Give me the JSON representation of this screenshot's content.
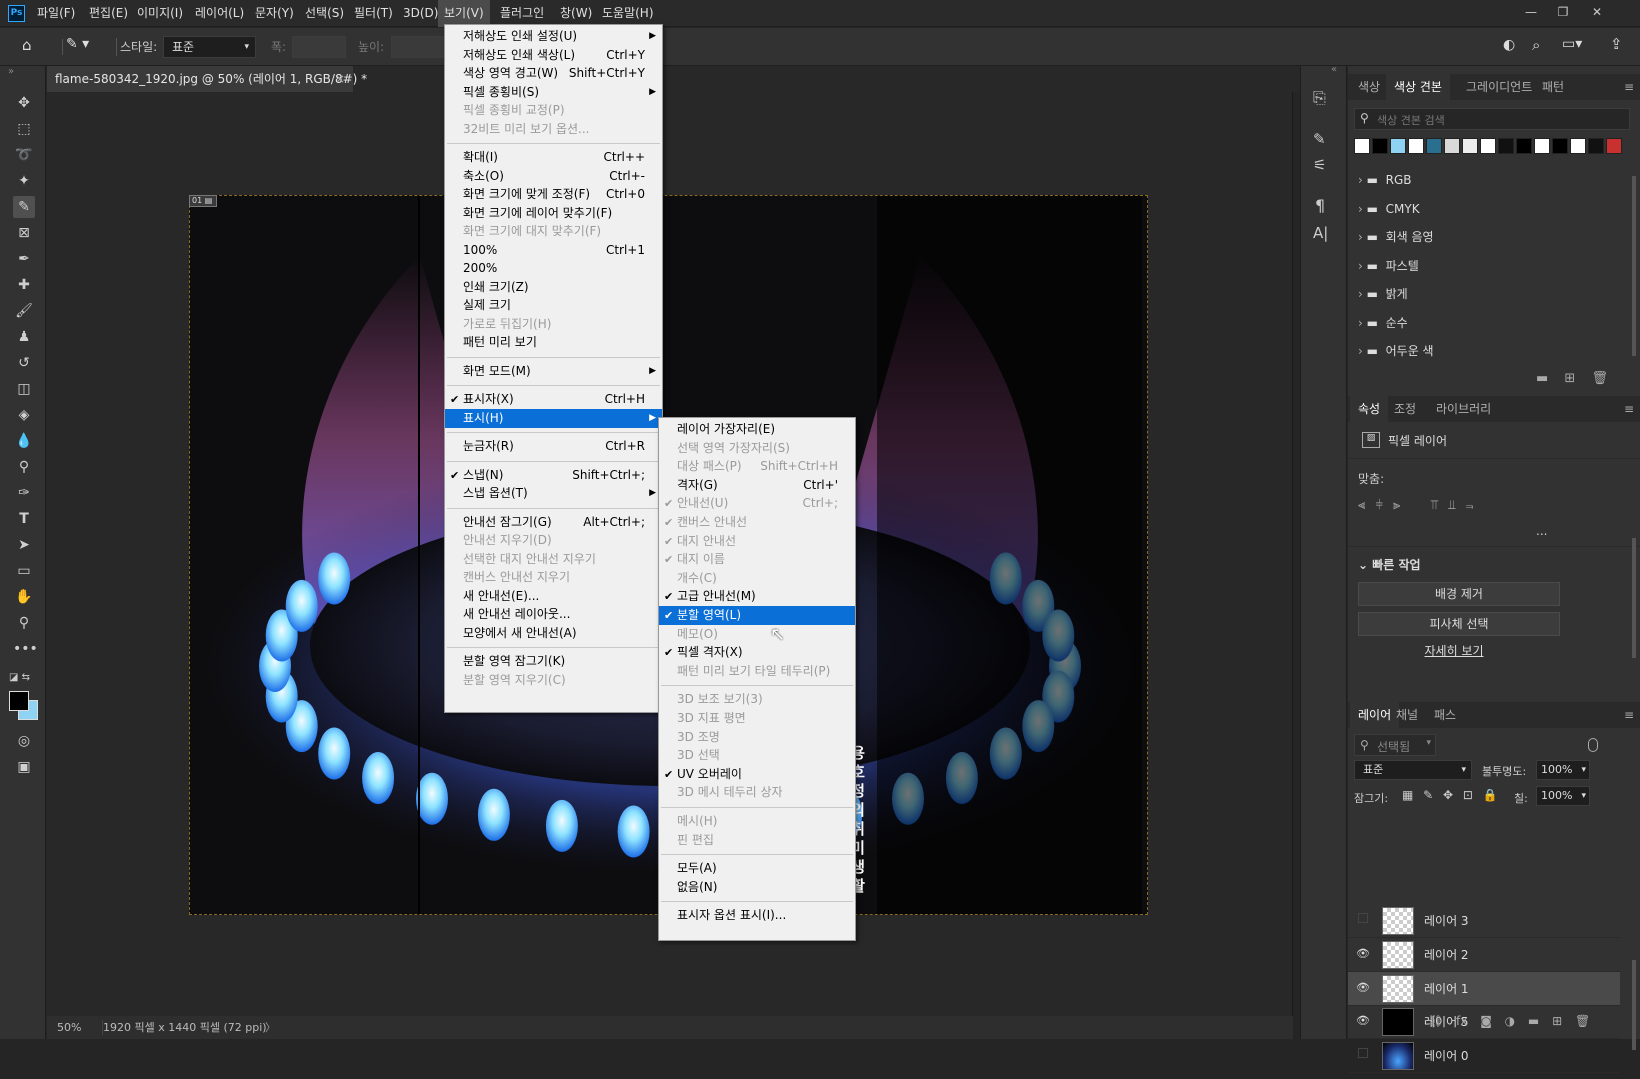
{
  "app": {
    "logo": "Ps"
  },
  "menubar": {
    "items": [
      "파일(F)",
      "편집(E)",
      "이미지(I)",
      "레이어(L)",
      "문자(Y)",
      "선택(S)",
      "필터(T)",
      "3D(D)",
      "보기(V)",
      "플러그인",
      "창(W)",
      "도움말(H)"
    ],
    "active_index": 8
  },
  "window_controls": [
    "minimize-icon",
    "restore-icon",
    "close-icon"
  ],
  "options_bar": {
    "style_label": "스타일:",
    "style_value": "표준",
    "width_label": "폭:",
    "height_label": "높이:"
  },
  "document": {
    "tab_title": "flame-580342_1920.jpg @ 50% (레이어 1, RGB/8#) *",
    "zoom": "50%",
    "info": "1920 픽셀 x 1440 픽셀 (72 ppi)",
    "watermark": "용호정의 취미생활"
  },
  "view_menu": [
    {
      "label": "저해상도 인쇄 설정(U)",
      "shortcut": "",
      "arrow": true,
      "disabled": false
    },
    {
      "label": "저해상도 인쇄 색상(L)",
      "shortcut": "Ctrl+Y",
      "disabled": false
    },
    {
      "label": "색상 영역 경고(W)",
      "shortcut": "Shift+Ctrl+Y",
      "disabled": false
    },
    {
      "label": "픽셀 종횡비(S)",
      "shortcut": "",
      "arrow": true,
      "disabled": false
    },
    {
      "label": "픽셀 종횡비 교정(P)",
      "shortcut": "",
      "disabled": true
    },
    {
      "label": "32비트 미리 보기 옵션...",
      "shortcut": "",
      "disabled": true
    },
    {
      "sep": true
    },
    {
      "label": "확대(I)",
      "shortcut": "Ctrl++",
      "disabled": false
    },
    {
      "label": "축소(O)",
      "shortcut": "Ctrl+-",
      "disabled": false
    },
    {
      "label": "화면 크기에 맞게 조정(F)",
      "shortcut": "Ctrl+0",
      "disabled": false
    },
    {
      "label": "화면 크기에 레이어 맞추기(F)",
      "shortcut": "",
      "disabled": false
    },
    {
      "label": "화면 크기에 대지 맞추기(F)",
      "shortcut": "",
      "disabled": true
    },
    {
      "label": "100%",
      "shortcut": "Ctrl+1",
      "disabled": false
    },
    {
      "label": "200%",
      "shortcut": "",
      "disabled": false
    },
    {
      "label": "인쇄 크기(Z)",
      "shortcut": "",
      "disabled": false
    },
    {
      "label": "실제 크기",
      "shortcut": "",
      "disabled": false
    },
    {
      "label": "가로로 뒤집기(H)",
      "shortcut": "",
      "disabled": true
    },
    {
      "label": "패턴 미리 보기",
      "shortcut": "",
      "disabled": false
    },
    {
      "sep": true
    },
    {
      "label": "화면 모드(M)",
      "shortcut": "",
      "arrow": true,
      "disabled": false
    },
    {
      "sep": true
    },
    {
      "label": "표시자(X)",
      "shortcut": "Ctrl+H",
      "checked": true,
      "disabled": false
    },
    {
      "label": "표시(H)",
      "shortcut": "",
      "arrow": true,
      "highlight": true,
      "disabled": false
    },
    {
      "sep": true
    },
    {
      "label": "눈금자(R)",
      "shortcut": "Ctrl+R",
      "disabled": false
    },
    {
      "sep": true
    },
    {
      "label": "스냅(N)",
      "shortcut": "Shift+Ctrl+;",
      "checked": true,
      "disabled": false
    },
    {
      "label": "스냅 옵션(T)",
      "shortcut": "",
      "arrow": true,
      "disabled": false
    },
    {
      "sep": true
    },
    {
      "label": "안내선 잠그기(G)",
      "shortcut": "Alt+Ctrl+;",
      "disabled": false
    },
    {
      "label": "안내선 지우기(D)",
      "shortcut": "",
      "disabled": true
    },
    {
      "label": "선택한 대지 안내선 지우기",
      "shortcut": "",
      "disabled": true
    },
    {
      "label": "캔버스 안내선 지우기",
      "shortcut": "",
      "disabled": true
    },
    {
      "label": "새 안내선(E)...",
      "shortcut": "",
      "disabled": false
    },
    {
      "label": "새 안내선 레이아웃...",
      "shortcut": "",
      "disabled": false
    },
    {
      "label": "모양에서 새 안내선(A)",
      "shortcut": "",
      "disabled": false
    },
    {
      "sep": true
    },
    {
      "label": "분할 영역 잠그기(K)",
      "shortcut": "",
      "disabled": false
    },
    {
      "label": "분할 영역 지우기(C)",
      "shortcut": "",
      "disabled": true
    }
  ],
  "show_submenu": [
    {
      "label": "레이어 가장자리(E)",
      "shortcut": "",
      "disabled": false
    },
    {
      "label": "선택 영역 가장자리(S)",
      "shortcut": "",
      "disabled": true
    },
    {
      "label": "대상 패스(P)",
      "shortcut": "Shift+Ctrl+H",
      "disabled": true
    },
    {
      "label": "격자(G)",
      "shortcut": "Ctrl+'",
      "disabled": false
    },
    {
      "label": "안내선(U)",
      "shortcut": "Ctrl+;",
      "checked": true,
      "disabled": true
    },
    {
      "label": "캔버스 안내선",
      "shortcut": "",
      "checked": true,
      "disabled": true
    },
    {
      "label": "대지 안내선",
      "shortcut": "",
      "checked": true,
      "disabled": true
    },
    {
      "label": "대지 이름",
      "shortcut": "",
      "checked": true,
      "disabled": true
    },
    {
      "label": "개수(C)",
      "shortcut": "",
      "disabled": true
    },
    {
      "label": "고급 안내선(M)",
      "shortcut": "",
      "checked": true,
      "disabled": false
    },
    {
      "label": "분할 영역(L)",
      "shortcut": "",
      "checked": true,
      "highlight": true,
      "disabled": false
    },
    {
      "label": "메모(O)",
      "shortcut": "",
      "disabled": true
    },
    {
      "label": "픽셀 격자(X)",
      "shortcut": "",
      "checked": true,
      "disabled": false
    },
    {
      "label": "패턴 미리 보기 타일 테두리(P)",
      "shortcut": "",
      "disabled": true
    },
    {
      "sep": true
    },
    {
      "label": "3D 보조 보기(3)",
      "shortcut": "",
      "disabled": true
    },
    {
      "label": "3D 지표 평면",
      "shortcut": "",
      "disabled": true
    },
    {
      "label": "3D 조명",
      "shortcut": "",
      "disabled": true
    },
    {
      "label": "3D 선택",
      "shortcut": "",
      "disabled": true
    },
    {
      "label": "UV 오버레이",
      "shortcut": "",
      "checked": true,
      "disabled": false
    },
    {
      "label": "3D 메시 테두리 상자",
      "shortcut": "",
      "disabled": true
    },
    {
      "sep": true
    },
    {
      "label": "메시(H)",
      "shortcut": "",
      "disabled": true
    },
    {
      "label": "핀 편집",
      "shortcut": "",
      "disabled": true
    },
    {
      "sep": true
    },
    {
      "label": "모두(A)",
      "shortcut": "",
      "disabled": false
    },
    {
      "label": "없음(N)",
      "shortcut": "",
      "disabled": false
    },
    {
      "sep": true
    },
    {
      "label": "표시자 옵션 표시(I)...",
      "shortcut": "",
      "disabled": false
    }
  ],
  "swatches_panel": {
    "tabs": [
      "색상",
      "색상 견본",
      "그레이디언트",
      "패턴"
    ],
    "active_tab": 1,
    "search_placeholder": "색상 견본 검색",
    "colors": [
      "#ffffff",
      "#000000",
      "#8fd3f4",
      "#ffffff",
      "#2a6f8f",
      "#d9d9d9",
      "#eeeeee",
      "#ffffff",
      "#111111",
      "#000000",
      "#ffffff",
      "#000000",
      "#ffffff",
      "#111111",
      "#c8312f"
    ],
    "folders": [
      "RGB",
      "CMYK",
      "회색 음영",
      "파스텔",
      "밝게",
      "순수",
      "어두운 색"
    ]
  },
  "properties_panel": {
    "tabs": [
      "속성",
      "조정",
      "라이브러리"
    ],
    "active_tab": 0,
    "type_label": "픽셀 레이어",
    "align_label": "맞춤:",
    "more": "...",
    "quick_actions_title": "빠른 작업",
    "buttons": [
      "배경 제거",
      "피사체 선택"
    ],
    "link": "자세히 보기"
  },
  "layers_panel": {
    "tabs": [
      "레이어",
      "채널",
      "패스"
    ],
    "active_tab": 0,
    "filter_placeholder": "선택됨",
    "blend_mode": "표준",
    "opacity_label": "불투명도:",
    "opacity": "100%",
    "lock_label": "잠그기:",
    "fill_label": "칠:",
    "fill": "100%",
    "layers": [
      {
        "name": "레이어 3",
        "visible": false,
        "selected": false
      },
      {
        "name": "레이어 2",
        "visible": true,
        "selected": false
      },
      {
        "name": "레이어 1",
        "visible": true,
        "selected": true
      },
      {
        "name": "레이어 5",
        "visible": true,
        "selected": false
      },
      {
        "name": "레이어 0",
        "visible": false,
        "selected": false
      }
    ]
  }
}
